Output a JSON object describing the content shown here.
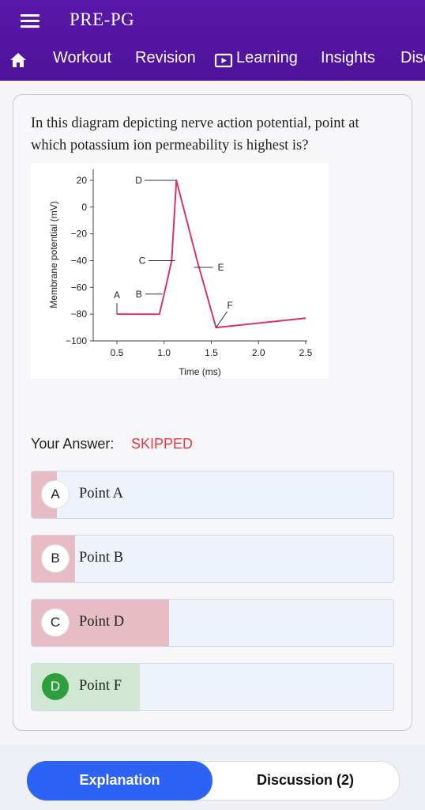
{
  "app": {
    "title": "PRE-PG"
  },
  "icons": {
    "menu": "hamburger-icon",
    "home": "home-icon",
    "learning": "play-box-icon"
  },
  "tabs": [
    {
      "label": "Workout"
    },
    {
      "label": "Revision"
    },
    {
      "label": "Learning"
    },
    {
      "label": "Insights"
    },
    {
      "label": "Disc"
    }
  ],
  "question": {
    "text": "In this diagram depicting nerve action potential, point at which potassium ion permeability is highest is?"
  },
  "figure": {
    "ylabel": "Membrane potential (mV)",
    "xlabel": "Time (ms)",
    "yticks": [
      "20",
      "0",
      "−20",
      "−40",
      "−60",
      "−80",
      "−100"
    ],
    "xticks": [
      "0.5",
      "1.0",
      "1.5",
      "2.0",
      "2.5"
    ],
    "points": [
      "A",
      "B",
      "C",
      "D",
      "E",
      "F"
    ],
    "colors": {
      "curve": "#d6336c"
    },
    "chart_data": {
      "type": "line",
      "x": [
        0.5,
        0.95,
        1.0,
        1.08,
        1.13,
        1.35,
        1.55,
        2.5
      ],
      "y": [
        -80,
        -80,
        -65,
        -40,
        20,
        -40,
        -90,
        -83
      ],
      "xlim": [
        0.5,
        2.5
      ],
      "ylim": [
        -100,
        20
      ]
    }
  },
  "answer": {
    "label": "Your Answer:",
    "value": "SKIPPED"
  },
  "options": [
    {
      "letter": "A",
      "text": "Point A",
      "share": 0.07,
      "bar_color": "#e8bcc4",
      "correct": false
    },
    {
      "letter": "B",
      "text": "Point B",
      "share": 0.12,
      "bar_color": "#e8bcc4",
      "correct": false
    },
    {
      "letter": "C",
      "text": "Point D",
      "share": 0.38,
      "bar_color": "#e8bcc4",
      "correct": false
    },
    {
      "letter": "D",
      "text": "Point F",
      "share": 0.3,
      "bar_color": "#cfe7d3",
      "correct": true
    }
  ],
  "bottom": {
    "explanation_label": "Explanation",
    "discussion_label": "Discussion (2)"
  }
}
